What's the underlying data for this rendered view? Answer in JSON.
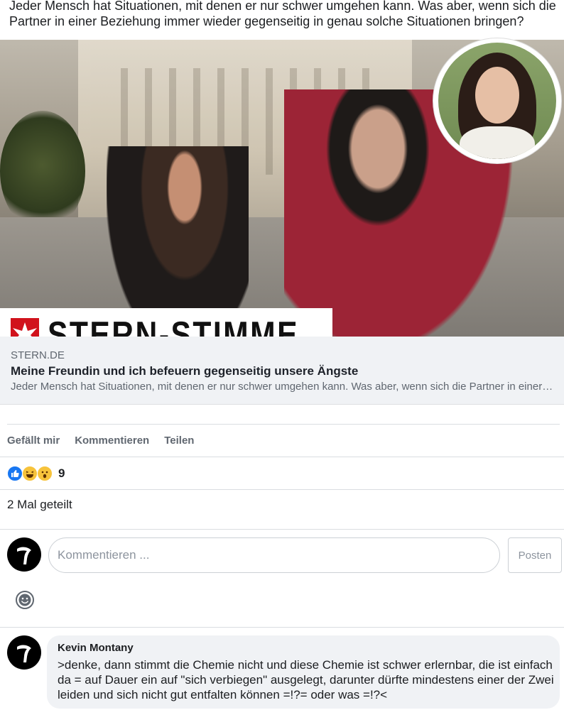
{
  "post": {
    "text": "Jeder Mensch hat Situationen, mit denen er nur schwer umgehen kann. Was aber, wenn sich die Partner in einer Beziehung immer wieder gegenseitig in genau solche Situationen bringen?"
  },
  "image": {
    "banner_text": "STERN-STIMME",
    "author_photo": "author-portrait"
  },
  "link_preview": {
    "domain": "STERN.DE",
    "title": "Meine Freundin und ich befeuern gegenseitig unsere Ängste",
    "description": "Jeder Mensch hat Situationen, mit denen er nur schwer umgehen kann. Was aber, wenn sich die Partner in einer Beziehung immer wieder gegenseitig in genau solche Situationen bringen?"
  },
  "actions": {
    "like": "Gefällt mir",
    "comment": "Kommentieren",
    "share": "Teilen"
  },
  "reactions": {
    "icons": [
      "like-icon",
      "haha-icon",
      "wow-icon"
    ],
    "count": "9"
  },
  "shares": "2 Mal geteilt",
  "composer": {
    "placeholder": "Kommentieren ...",
    "post_button": "Posten"
  },
  "comments": [
    {
      "author": "Kevin Montany",
      "text": ">denke, dann stimmt die Chemie nicht und diese Chemie ist schwer erlernbar, die ist einfach da = auf Dauer ein auf \"sich verbiegen\" ausgelegt, darunter dürfte mindestens einer der Zwei leiden und sich nicht gut entfalten können =!?= oder was =!?<"
    }
  ],
  "colors": {
    "brand_red": "#d1121c",
    "like_blue": "#1877f2",
    "preview_bg": "#f0f2f5"
  }
}
